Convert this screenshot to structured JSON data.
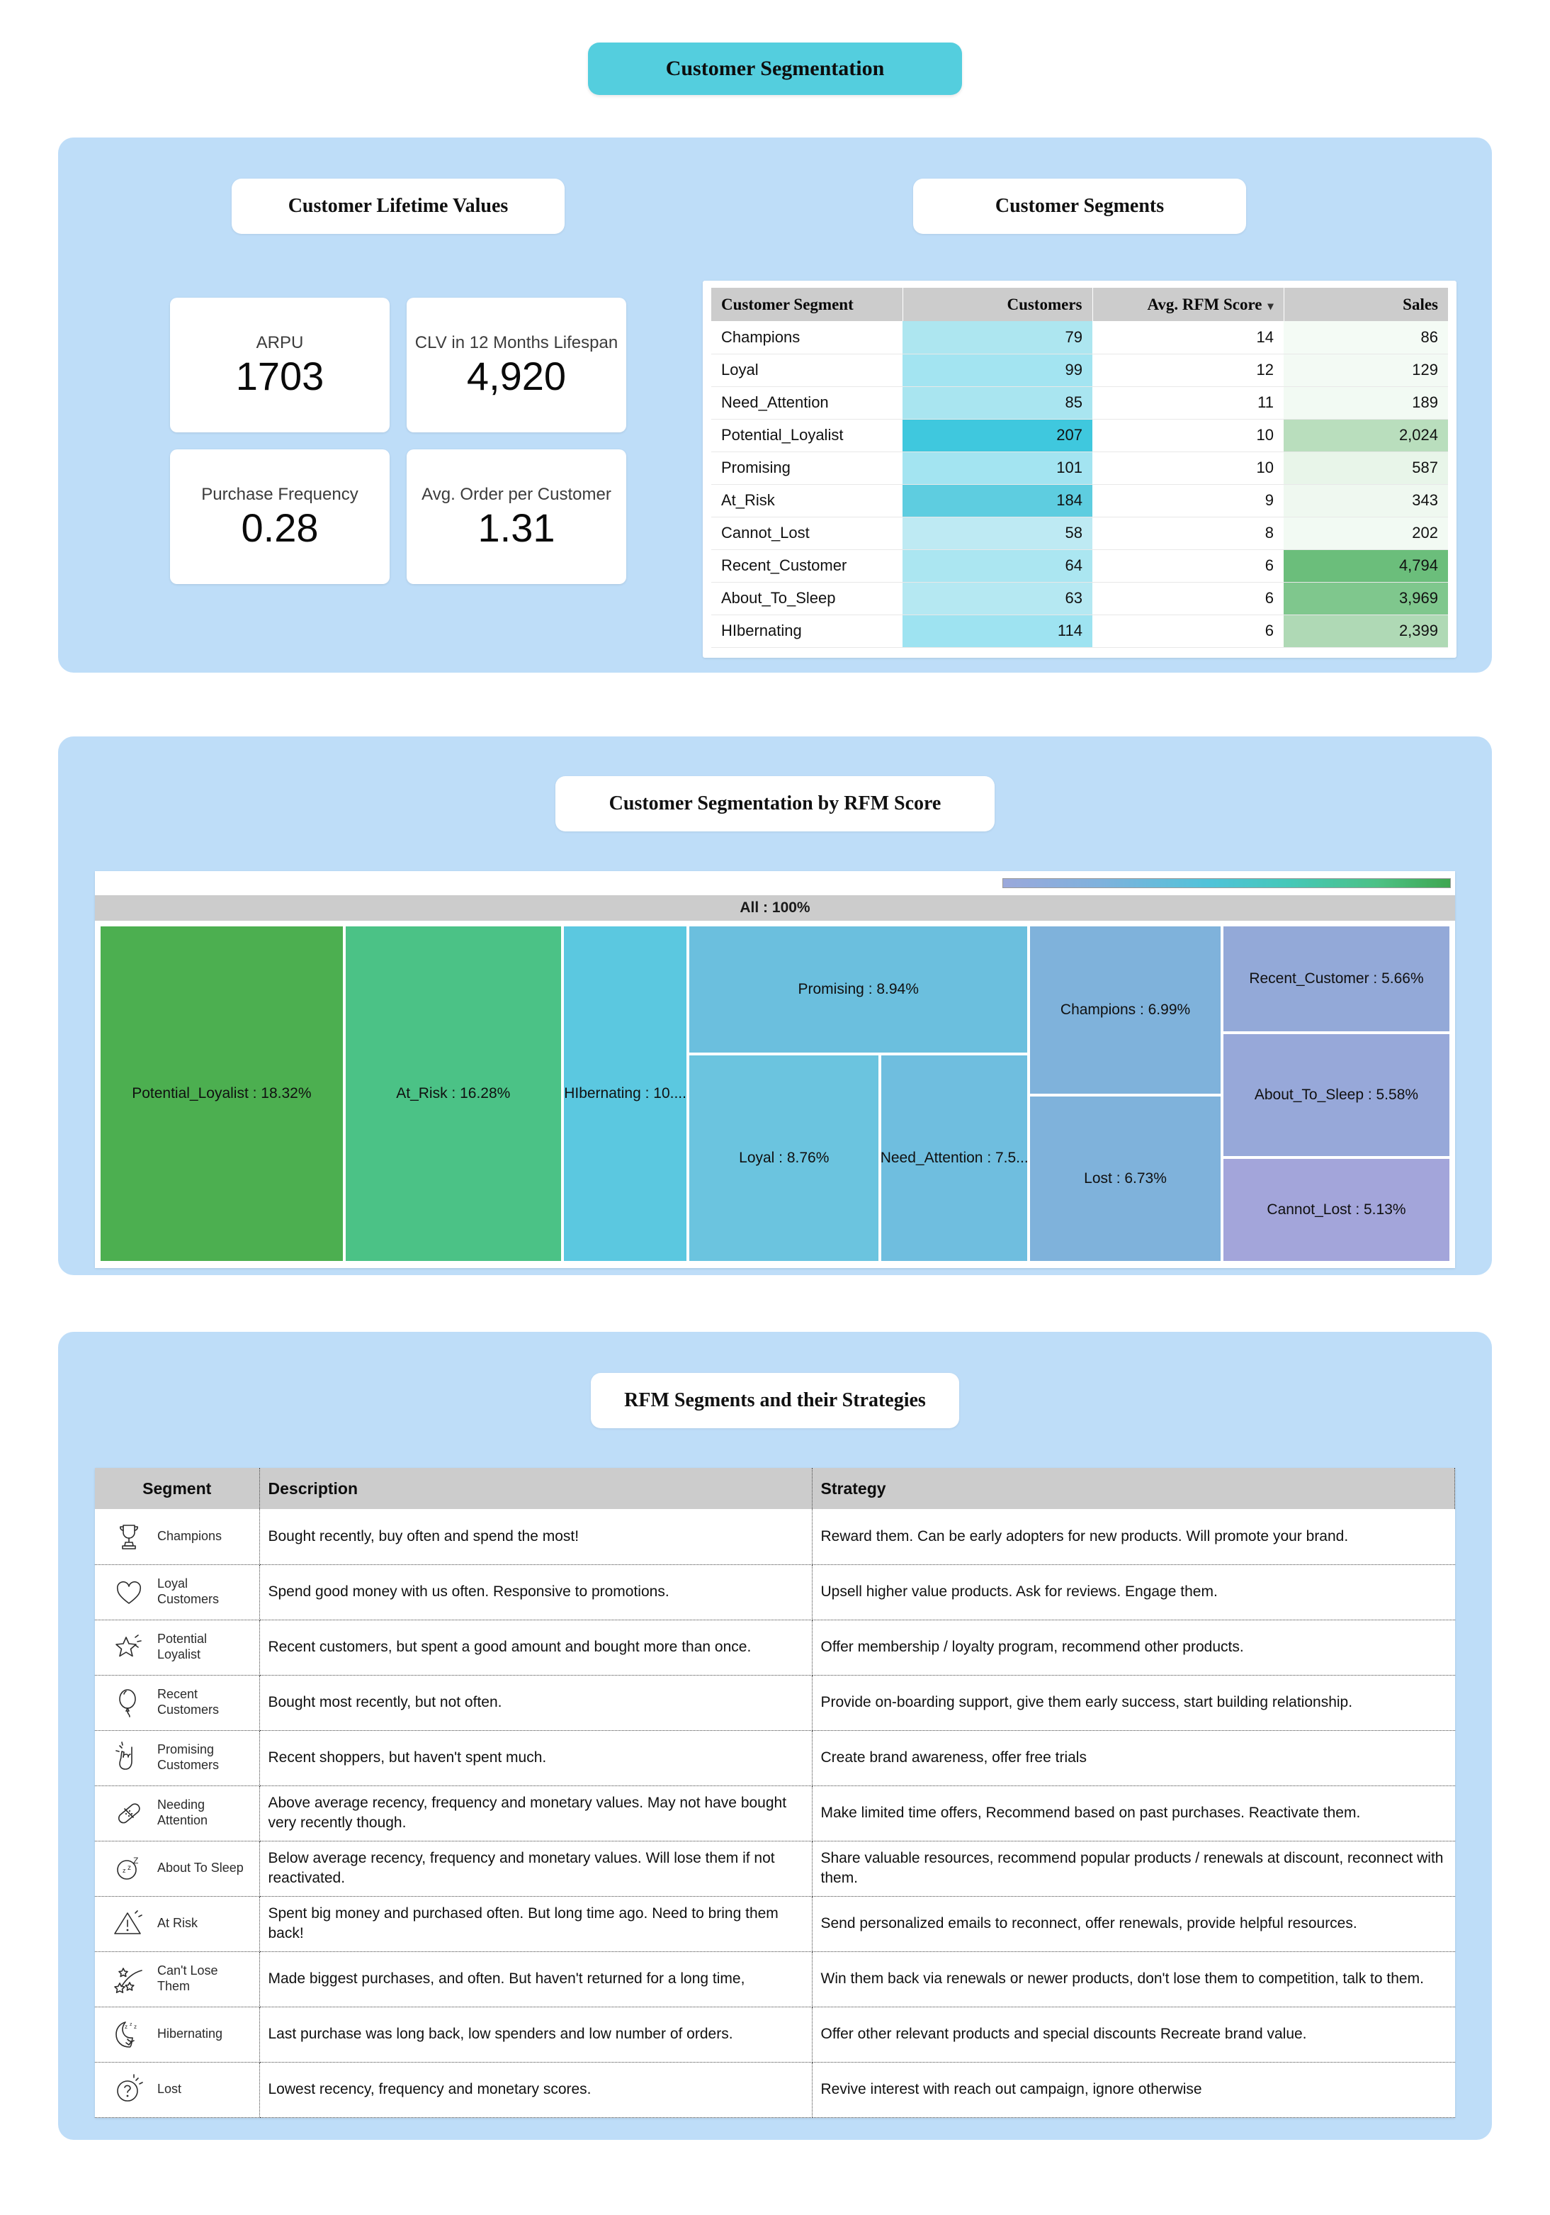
{
  "dashboard": {
    "title": "Customer Segmentation"
  },
  "clv": {
    "title": "Customer Lifetime Values",
    "kpis": [
      {
        "label": "ARPU",
        "value": "1703"
      },
      {
        "label": "CLV in 12 Months Lifespan",
        "value": "4,920"
      },
      {
        "label": "Purchase Frequency",
        "value": "0.28"
      },
      {
        "label": "Avg. Order per Customer",
        "value": "1.31"
      }
    ]
  },
  "segments": {
    "title": "Customer Segments",
    "columns": [
      "Customer Segment",
      "Customers",
      "Avg. RFM Score",
      "Sales"
    ],
    "sort_column": "Avg. RFM Score",
    "sort_caret": "▾",
    "rows": [
      {
        "segment": "Champions",
        "customers": "79",
        "rfm": "14",
        "sales": "86",
        "cust_fill": "#ADE6F0",
        "sales_fill": "#F4FBF5"
      },
      {
        "segment": "Loyal",
        "customers": "99",
        "rfm": "12",
        "sales": "129",
        "cust_fill": "#A3E4F1",
        "sales_fill": "#F3FAF4"
      },
      {
        "segment": "Need_Attention",
        "customers": "85",
        "rfm": "11",
        "sales": "189",
        "cust_fill": "#A9E5F0",
        "sales_fill": "#F2FAF3"
      },
      {
        "segment": "Potential_Loyalist",
        "customers": "207",
        "rfm": "10",
        "sales": "2,024",
        "cust_fill": "#3FC8DE",
        "sales_fill": "#B9DEBD"
      },
      {
        "segment": "Promising",
        "customers": "101",
        "rfm": "10",
        "sales": "587",
        "cust_fill": "#A3E4F1",
        "sales_fill": "#E8F5E9"
      },
      {
        "segment": "At_Risk",
        "customers": "184",
        "rfm": "9",
        "sales": "343",
        "cust_fill": "#5ECDE0",
        "sales_fill": "#EFF8F0"
      },
      {
        "segment": "Cannot_Lost",
        "customers": "58",
        "rfm": "8",
        "sales": "202",
        "cust_fill": "#BEEAF3",
        "sales_fill": "#F2FAF3"
      },
      {
        "segment": "Recent_Customer",
        "customers": "64",
        "rfm": "6",
        "sales": "4,794",
        "cust_fill": "#ABE6F1",
        "sales_fill": "#6BBE7B"
      },
      {
        "segment": "About_To_Sleep",
        "customers": "63",
        "rfm": "6",
        "sales": "3,969",
        "cust_fill": "#B5E8F2",
        "sales_fill": "#7FC78D"
      },
      {
        "segment": "HIbernating",
        "customers": "114",
        "rfm": "6",
        "sales": "2,399",
        "cust_fill": "#9EE3F1",
        "sales_fill": "#AFD9B5"
      }
    ]
  },
  "chart_data": {
    "type": "treemap",
    "title": "Customer Segmentation by RFM Score",
    "root_label": "All : 100%",
    "legend": {
      "position": "top-right",
      "type": "continuous-gradient",
      "colors": [
        "#9aa8db",
        "#50c3d9",
        "#3fa650"
      ]
    },
    "categories": [
      "Potential_Loyalist",
      "At_Risk",
      "HIbernating",
      "Promising",
      "Loyal",
      "Need_Attention",
      "Champions",
      "Lost",
      "Recent_Customer",
      "About_To_Sleep",
      "Cannot_Lost"
    ],
    "values": [
      18.32,
      16.28,
      10.0,
      8.94,
      8.76,
      7.5,
      6.99,
      6.73,
      5.66,
      5.58,
      5.13
    ],
    "unit": "%",
    "tiles": [
      {
        "label": "Potential_Loyalist : 18.32%",
        "value": 18.32,
        "color": "#4CAF50",
        "x": 0,
        "y": 0,
        "w": 18.12,
        "h": 100
      },
      {
        "label": "At_Risk : 16.28%",
        "value": 16.28,
        "color": "#4BC286",
        "x": 18.12,
        "y": 0,
        "w": 16.15,
        "h": 100
      },
      {
        "label": "HIbernating : 10....",
        "value": 10.0,
        "color": "#5BC8E0",
        "x": 34.27,
        "y": 0,
        "w": 9.3,
        "h": 100
      },
      {
        "label": "Promising : 8.94%",
        "value": 8.94,
        "color": "#6BBFDE",
        "x": 43.57,
        "y": 0,
        "w": 25.2,
        "h": 38.2
      },
      {
        "label": "Loyal : 8.76%",
        "value": 8.76,
        "color": "#6BC4DF",
        "x": 43.57,
        "y": 38.2,
        "w": 14.2,
        "h": 61.8
      },
      {
        "label": "Need_Attention : 7.5...",
        "value": 7.5,
        "color": "#6FBEDF",
        "x": 57.77,
        "y": 38.2,
        "w": 11.0,
        "h": 61.8
      },
      {
        "label": "Champions : 6.99%",
        "value": 6.99,
        "color": "#7FB2DB",
        "x": 68.77,
        "y": 0,
        "w": 14.3,
        "h": 50.5
      },
      {
        "label": "Lost : 6.73%",
        "value": 6.73,
        "color": "#7FB2DB",
        "x": 68.77,
        "y": 50.5,
        "w": 14.3,
        "h": 49.5
      },
      {
        "label": "Recent_Customer : 5.66%",
        "value": 5.66,
        "color": "#93A9D8",
        "x": 83.07,
        "y": 0,
        "w": 16.93,
        "h": 32.0
      },
      {
        "label": "About_To_Sleep : 5.58%",
        "value": 5.58,
        "color": "#97A8D9",
        "x": 83.07,
        "y": 32.0,
        "w": 16.93,
        "h": 37.0
      },
      {
        "label": "Cannot_Lost : 5.13%",
        "value": 5.13,
        "color": "#A3A5DA",
        "x": 83.07,
        "y": 69.0,
        "w": 16.93,
        "h": 31.0
      }
    ]
  },
  "strategies": {
    "title": "RFM Segments and their Strategies",
    "columns": [
      "Segment",
      "Description",
      "Strategy"
    ],
    "rows": [
      {
        "icon": "trophy-icon",
        "segment": "Champions",
        "description": "Bought recently, buy often and spend the most!",
        "strategy": "Reward them. Can be early adopters for new products. Will promote your brand."
      },
      {
        "icon": "heart-icon",
        "segment": "Loyal Customers",
        "description": "Spend good money with us often. Responsive to promotions.",
        "strategy": "Upsell higher value products. Ask for reviews. Engage them."
      },
      {
        "icon": "star-icon",
        "segment": "Potential Loyalist",
        "description": "Recent customers, but spent a good amount and bought more than once.",
        "strategy": "Offer membership / loyalty program, recommend other products."
      },
      {
        "icon": "balloon-icon",
        "segment": "Recent Customers",
        "description": "Bought most recently, but not often.",
        "strategy": "Provide on-boarding support, give them early success, start building relationship."
      },
      {
        "icon": "pointing-hand-icon",
        "segment": "Promising Customers",
        "description": "Recent shoppers, but haven't spent much.",
        "strategy": "Create brand awareness, offer free trials"
      },
      {
        "icon": "bandage-icon",
        "segment": "Needing Attention",
        "description": "Above average recency, frequency and monetary values. May not have bought very recently though.",
        "strategy": "Make limited time offers, Recommend based on past purchases. Reactivate them."
      },
      {
        "icon": "sleeping-face-icon",
        "segment": "About To Sleep",
        "description": "Below average recency, frequency and monetary values. Will lose them if not reactivated.",
        "strategy": "Share valuable resources, recommend popular products / renewals at discount, reconnect with them."
      },
      {
        "icon": "warning-triangle-icon",
        "segment": "At Risk",
        "description": "Spent big money and purchased often. But long time ago. Need to bring them back!",
        "strategy": "Send personalized emails to reconnect, offer renewals, provide helpful resources."
      },
      {
        "icon": "shooting-stars-icon",
        "segment": "Can't Lose Them",
        "description": "Made biggest purchases, and often. But haven't returned for a long time,",
        "strategy": "Win them back via renewals or newer products, don't lose them to competition, talk to them."
      },
      {
        "icon": "hibernating-icon",
        "segment": "Hibernating",
        "description": "Last purchase was long back, low spenders and low number of orders.",
        "strategy": "Offer other relevant products and special discounts Recreate brand value."
      },
      {
        "icon": "question-circle-icon",
        "segment": "Lost",
        "description": "Lowest recency, frequency and monetary scores.",
        "strategy": "Revive interest with reach out campaign, ignore otherwise"
      }
    ]
  }
}
